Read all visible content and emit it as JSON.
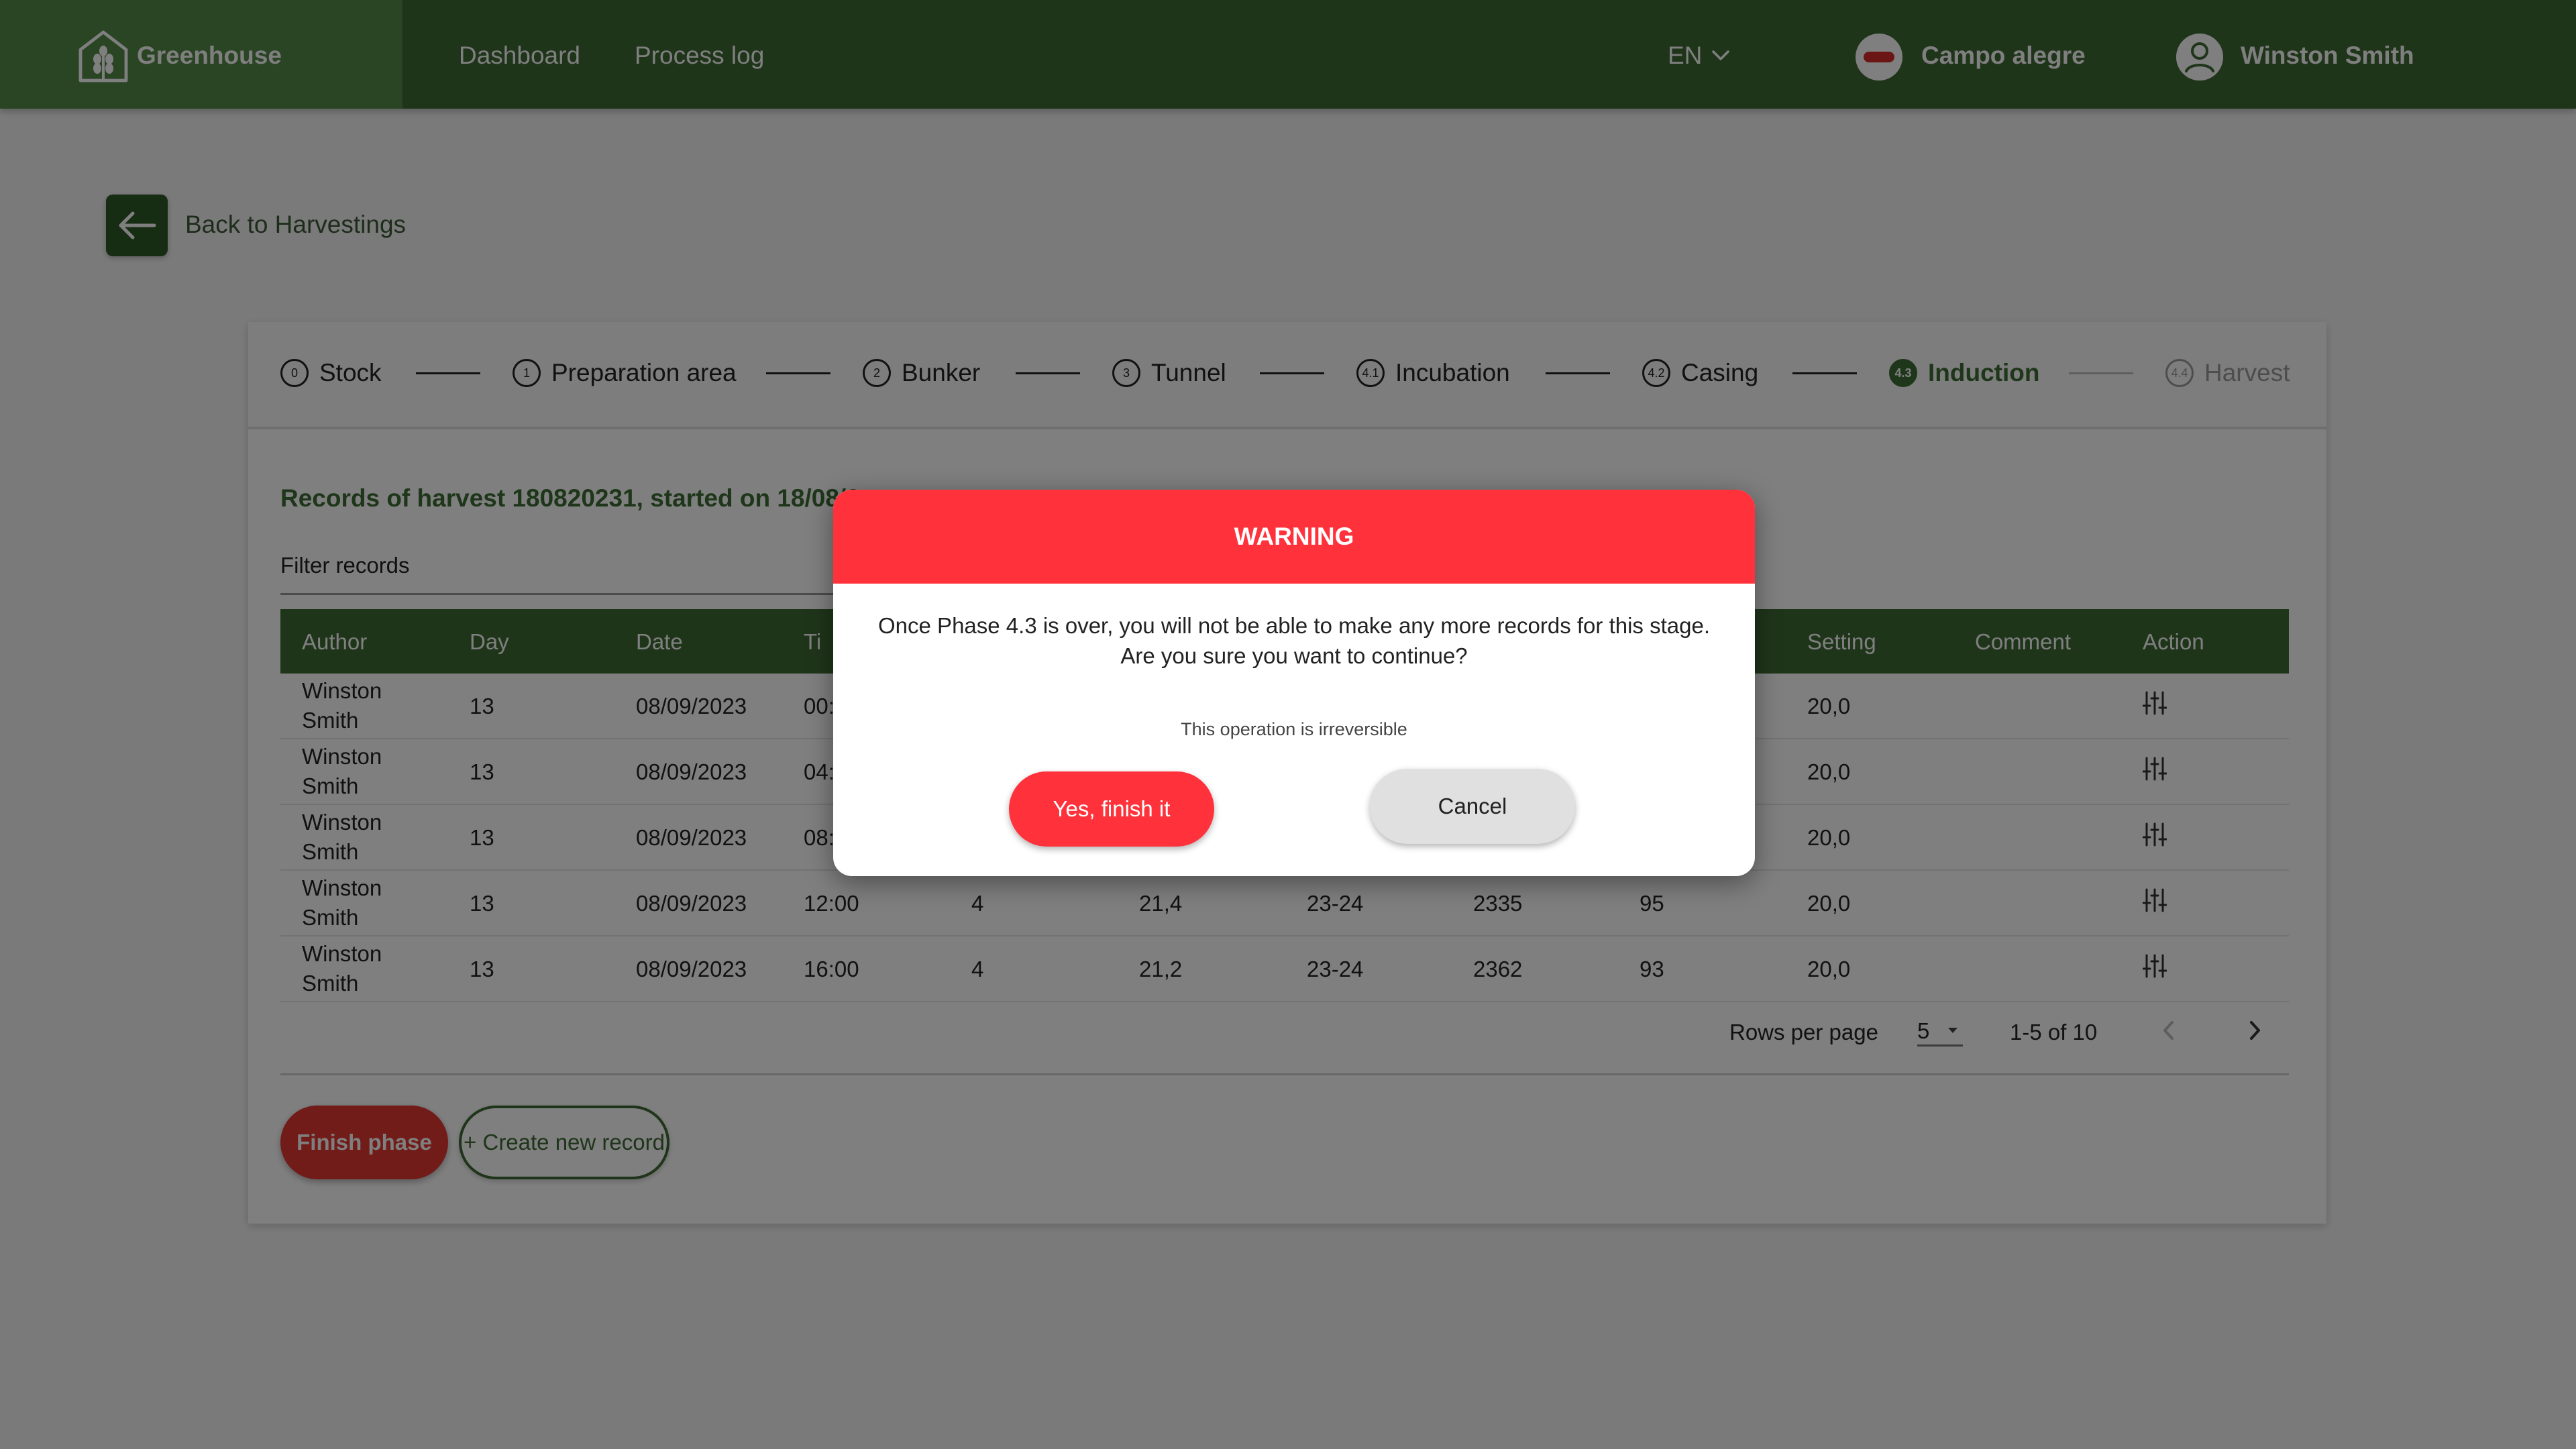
{
  "header": {
    "brand": "Greenhouse",
    "nav": [
      "Dashboard",
      "Process log"
    ],
    "language": "EN",
    "farm": "Campo alegre",
    "user": "Winston Smith"
  },
  "back_label": "Back to Harvestings",
  "steps": [
    {
      "num": "0",
      "label": "Stock"
    },
    {
      "num": "1",
      "label": "Preparation area"
    },
    {
      "num": "2",
      "label": "Bunker"
    },
    {
      "num": "3",
      "label": "Tunnel"
    },
    {
      "num": "4.1",
      "label": "Incubation"
    },
    {
      "num": "4.2",
      "label": "Casing"
    },
    {
      "num": "4.3",
      "label": "Induction",
      "state": "active"
    },
    {
      "num": "4.4",
      "label": "Harvest",
      "state": "disabled"
    }
  ],
  "records_title": "Records of harvest 180820231, started on 18/08/2",
  "filter_label": "Filter records",
  "table": {
    "headers": [
      "Author",
      "Day",
      "Date",
      "Ti",
      "Setting",
      "Comment",
      "Action"
    ],
    "rows": [
      {
        "author": "Winston Smith",
        "day": "13",
        "date": "08/09/2023",
        "time": "00:",
        "setting": "20,0"
      },
      {
        "author": "Winston Smith",
        "day": "13",
        "date": "08/09/2023",
        "time": "04:",
        "setting": "20,0"
      },
      {
        "author": "Winston Smith",
        "day": "13",
        "date": "08/09/2023",
        "time": "08:",
        "setting": "20,0"
      },
      {
        "author": "Winston Smith",
        "day": "13",
        "date": "08/09/2023",
        "time": "12:00",
        "c5": "4",
        "c6": "21,4",
        "c7": "23-24",
        "c8": "2335",
        "c9": "95",
        "setting": "20,0"
      },
      {
        "author": "Winston Smith",
        "day": "13",
        "date": "08/09/2023",
        "time": "16:00",
        "c5": "4",
        "c6": "21,2",
        "c7": "23-24",
        "c8": "2362",
        "c9": "93",
        "setting": "20,0"
      }
    ]
  },
  "pagination": {
    "rows_per_page_label": "Rows per page",
    "rows_per_page": "5",
    "range": "1-5 of 10"
  },
  "buttons": {
    "finish": "Finish phase",
    "create": "+ Create new record"
  },
  "modal": {
    "title": "WARNING",
    "message": "Once Phase 4.3 is over, you will not be able to make any more records for this stage. Are you sure you want to continue?",
    "note": "This operation is irreversible",
    "confirm": "Yes, finish it",
    "cancel": "Cancel"
  },
  "colors": {
    "primary_green": "#3f6b35",
    "brand_green": "#548a49",
    "warning_red": "#ff323b",
    "finish_red": "#e53935"
  },
  "icons": {
    "logo": "greenhouse-logo-icon",
    "language_dropdown": "chevron-down-icon",
    "farm": "farm-badge-icon",
    "user": "user-avatar-icon",
    "back": "arrow-left-icon",
    "row_action": "sliders-icon",
    "pager_prev": "chevron-left-icon",
    "pager_next": "chevron-right-icon"
  }
}
